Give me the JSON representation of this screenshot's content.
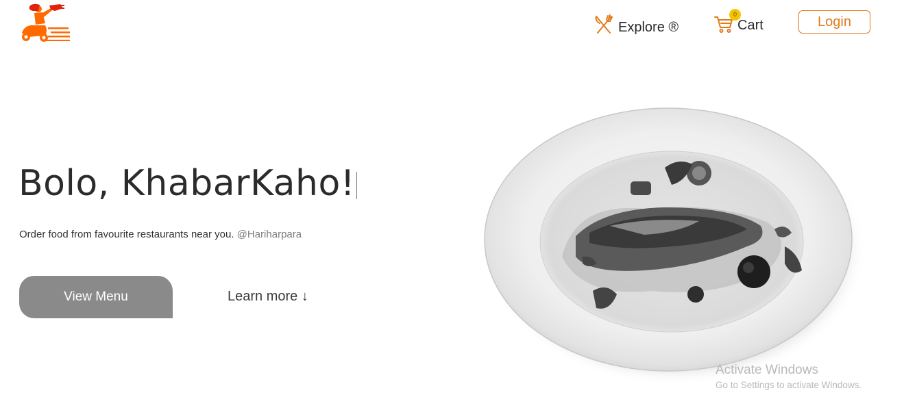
{
  "header": {
    "logo": {
      "icon": "scooter-delivery-logo",
      "colors": [
        "#ff6a00",
        "#e0230d"
      ]
    },
    "nav": {
      "explore_label": "Explore ®",
      "explore_icon": "fork-knife-icon",
      "cart_label": "Cart",
      "cart_icon": "cart-icon",
      "cart_count": "0",
      "login_label": "Login"
    }
  },
  "hero": {
    "title": "Bolo, KhabarKaho!",
    "subtitle": "Order food from favourite restaurants near you.",
    "location": "@Hariharpara",
    "primary_button": "View Menu",
    "secondary_link": "Learn more ↓",
    "image": "grayscale-plated-fish-dish"
  },
  "watermark": {
    "line1": "Activate Windows",
    "line2": "Go to Settings to activate Windows."
  },
  "colors": {
    "accent": "#e07b1a",
    "badge": "#f5c400",
    "button_gray": "#8a8a8a"
  }
}
